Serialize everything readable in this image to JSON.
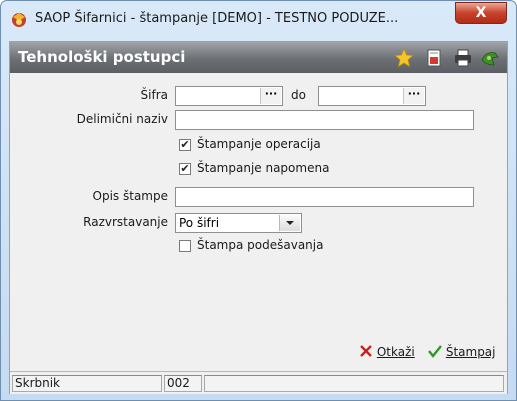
{
  "window": {
    "title": "SAOP Šifarnici - štampanje [DEMO] - TESTNO PODUZE...",
    "close_label": "X"
  },
  "header": {
    "title": "Tehnološki postupci",
    "icons": [
      "star-icon",
      "document-icon",
      "printer-icon",
      "exit-icon"
    ]
  },
  "form": {
    "sifra_label": "Šifra",
    "sifra_from_value": "",
    "sifra_to_label": "do",
    "sifra_to_value": "",
    "lookup_label": "···",
    "naziv_label": "Delimični naziv",
    "naziv_value": "",
    "stampanje_operacija_label": "Štampanje operacija",
    "stampanje_operacija_checked": true,
    "stampanje_napomena_label": "Štampanje napomena",
    "stampanje_napomena_checked": true,
    "opis_label": "Opis štampe",
    "opis_value": "",
    "razvrstavanje_label": "Razvrstavanje",
    "razvrstavanje_value": "Po šifri",
    "stampa_podesavanja_label": "Štampa podešavanja",
    "stampa_podesavanja_checked": false,
    "check_mark": "✔"
  },
  "buttons": {
    "cancel_label": "Otkaži",
    "print_label": "Štampaj"
  },
  "status": {
    "user": "Skrbnik",
    "code": "002",
    "info": ""
  },
  "colors": {
    "header_gray": "#6c7074",
    "cancel_red": "#c8241b",
    "print_green": "#2f9a1f"
  }
}
